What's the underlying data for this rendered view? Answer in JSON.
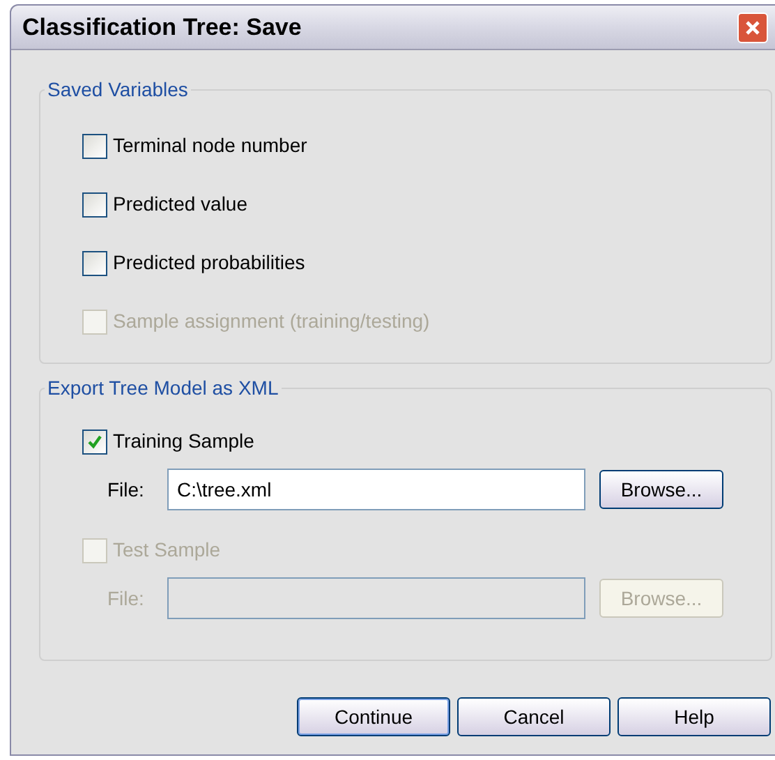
{
  "window": {
    "title": "Classification Tree: Save"
  },
  "saved_variables": {
    "title": "Saved Variables",
    "options": [
      {
        "label": "Terminal node number",
        "checked": false,
        "disabled": false
      },
      {
        "label": "Predicted value",
        "checked": false,
        "disabled": false
      },
      {
        "label": "Predicted probabilities",
        "checked": false,
        "disabled": false
      },
      {
        "label": "Sample assignment (training/testing)",
        "checked": false,
        "disabled": true
      }
    ]
  },
  "export": {
    "title": "Export Tree Model as XML",
    "samples": [
      {
        "label": "Training Sample",
        "checked": true,
        "disabled": false,
        "file_label": "File:",
        "file_value": "C:\\tree.xml",
        "browse": "Browse..."
      },
      {
        "label": "Test Sample",
        "checked": false,
        "disabled": true,
        "file_label": "File:",
        "browse": "Browse..."
      }
    ]
  },
  "buttons": [
    {
      "label": "Continue",
      "default": true
    },
    {
      "label": "Cancel",
      "default": false
    },
    {
      "label": "Help",
      "default": false
    }
  ]
}
